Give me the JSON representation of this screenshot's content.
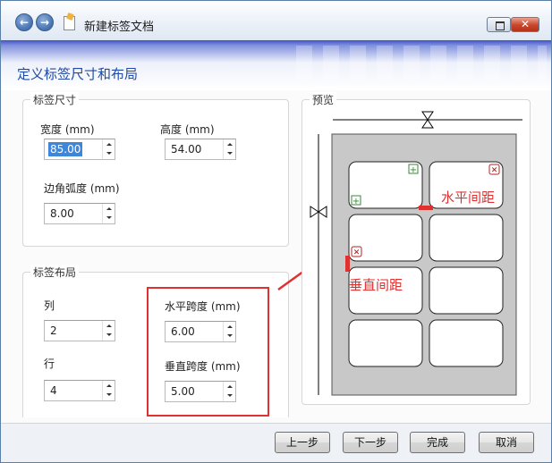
{
  "window": {
    "title": "新建标签文档"
  },
  "wizard": {
    "page_title": "定义标签尺寸和布局"
  },
  "size_group": {
    "title": "标签尺寸",
    "width_label": "宽度 (mm)",
    "width_value": "85.00",
    "height_label": "高度 (mm)",
    "height_value": "54.00",
    "radius_label": "边角弧度 (mm)",
    "radius_value": "8.00"
  },
  "layout_group": {
    "title": "标签布局",
    "columns_label": "列",
    "columns_value": "2",
    "rows_label": "行",
    "rows_value": "4",
    "h_spacing_label": "水平跨度 (mm)",
    "h_spacing_value": "6.00",
    "v_spacing_label": "垂直跨度 (mm)",
    "v_spacing_value": "5.00"
  },
  "preview": {
    "title": "预览",
    "h_gap_annotation": "水平间距",
    "v_gap_annotation": "垂直间距",
    "columns": 2,
    "rows": 4,
    "colors": {
      "sheet": "#c8c8c8",
      "label": "#ffffff",
      "annotation": "#e03131"
    }
  },
  "footer": {
    "prev_label": "上一步",
    "next_label": "下一步",
    "finish_label": "完成",
    "cancel_label": "取消"
  }
}
